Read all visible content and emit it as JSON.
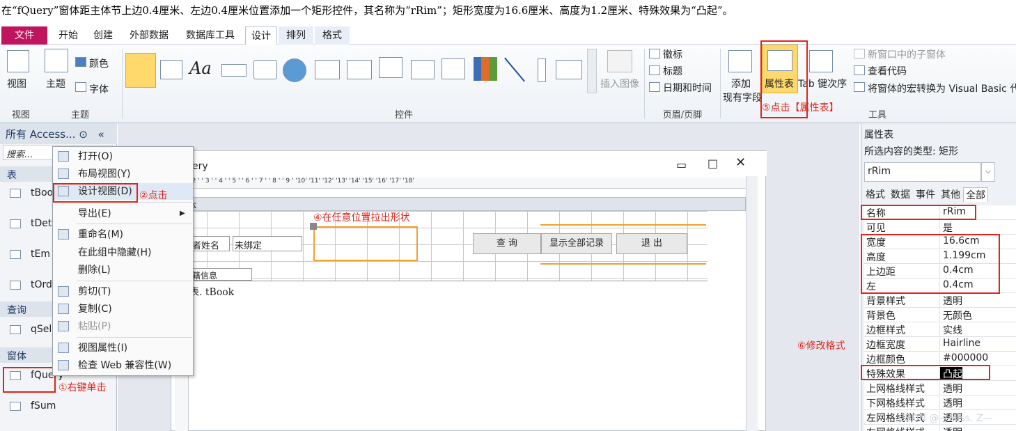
{
  "instruction": "在“fQuery”窗体距主体节上边0.4厘米、左边0.4厘米位置添加一个矩形控件，其名称为“rRim”；矩形宽度为16.6厘米、高度为1.2厘米、特殊效果为“凸起”。",
  "tabs": [
    "文件",
    "开始",
    "创建",
    "外部数据",
    "数据库工具",
    "设计",
    "排列",
    "格式"
  ],
  "ribbon": {
    "view_label": "视图",
    "theme_label": "主题",
    "color_label": "颜色",
    "font_label": "字体",
    "insert_image": "插入图像",
    "logo": "徽标",
    "title": "标题",
    "datetime": "日期和时间",
    "add_field_1": "添加",
    "add_field_2": "现有字段",
    "property_sheet": "属性表",
    "tab_order": "Tab 键次序",
    "new_sub": "新窗口中的子窗体",
    "view_code": "查看代码",
    "convert_macro": "将窗体的宏转换为 Visual Basic 代",
    "groups": [
      "视图",
      "主题",
      "控件",
      "页眉/页脚",
      "工具"
    ]
  },
  "nav": {
    "header": "所有 Access...",
    "search_placeholder": "搜索...",
    "sections": [
      "表",
      "查询",
      "窗体"
    ],
    "tables": [
      "tBoo",
      "tDet",
      "tEm",
      "tOrd"
    ],
    "queries": [
      "qSel"
    ],
    "forms": [
      "fQuery",
      "fSum"
    ]
  },
  "context_menu": [
    "打开(O)",
    "布局视图(Y)",
    "设计视图(D)",
    "导出(E)",
    "重命名(M)",
    "在此组中隐藏(H)",
    "删除(L)",
    "剪切(T)",
    "复制(C)",
    "粘贴(P)",
    "视图属性(I)",
    "检查 Web 兼容性(W)"
  ],
  "form": {
    "title": "ery",
    "ruler": "' 1 ' ' 2 ' ' 3 ' ' 4 ' ' 5 ' ' 6 ' ' 7 ' ' 8 ' ' 9 ' '10' '11' '12' '13' '14' '15' '16' '17' '18'",
    "section": "主体",
    "author_label": "作者姓名",
    "unbound": "未绑定",
    "book_info": "书籍信息",
    "btn_query": "查 询",
    "btn_show_all": "显示全部记录",
    "btn_exit": "退 出",
    "datasource": "表. tBook"
  },
  "props": {
    "header": "属性表",
    "type_label": "所选内容的类型: 矩形",
    "selected": "rRim",
    "tabs": [
      "格式",
      "数据",
      "事件",
      "其他",
      "全部"
    ],
    "rows": [
      [
        "名称",
        "rRim"
      ],
      [
        "可见",
        "是"
      ],
      [
        "宽度",
        "16.6cm"
      ],
      [
        "高度",
        "1.199cm"
      ],
      [
        "上边距",
        "0.4cm"
      ],
      [
        "左",
        "0.4cm"
      ],
      [
        "背景样式",
        "透明"
      ],
      [
        "背景色",
        "无颜色"
      ],
      [
        "边框样式",
        "实线"
      ],
      [
        "边框宽度",
        "Hairline"
      ],
      [
        "边框颜色",
        "#000000"
      ],
      [
        "特殊效果",
        "凸起"
      ],
      [
        "上网格线样式",
        "透明"
      ],
      [
        "下网格线样式",
        "透明"
      ],
      [
        "左网格线样式",
        "透明"
      ],
      [
        "右网格线样式",
        "透明"
      ]
    ]
  },
  "annotations": {
    "a1": "①右键单击",
    "a2": "②点击",
    "a4": "④在任意位置拉出形状",
    "a5": "⑤点击【属性表】",
    "a6": "⑥修改格式",
    "watermark": "CSDN @—Miss. Z—"
  },
  "colors": {
    "file_tab": "#c0155e",
    "annotation": "#e2231a",
    "selection": "#f0a030"
  }
}
